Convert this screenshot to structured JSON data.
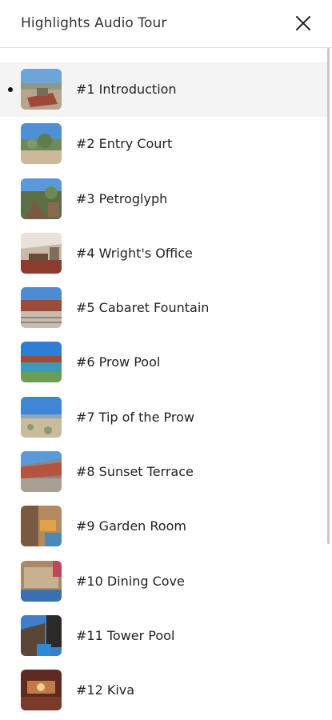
{
  "header": {
    "title": "Highlights Audio Tour",
    "close_icon": "close-icon"
  },
  "tour": {
    "active_index": 0,
    "stops": [
      {
        "label": "#1 Introduction",
        "thumb": "introduction-thumbnail"
      },
      {
        "label": "#2 Entry Court",
        "thumb": "entry-court-thumbnail"
      },
      {
        "label": "#3 Petroglyph",
        "thumb": "petroglyph-thumbnail"
      },
      {
        "label": "#4 Wright's Office",
        "thumb": "wrights-office-thumbnail"
      },
      {
        "label": "#5 Cabaret Fountain",
        "thumb": "cabaret-fountain-thumbnail"
      },
      {
        "label": "#6 Prow Pool",
        "thumb": "prow-pool-thumbnail"
      },
      {
        "label": "#7 Tip of the Prow",
        "thumb": "tip-of-the-prow-thumbnail"
      },
      {
        "label": "#8 Sunset Terrace",
        "thumb": "sunset-terrace-thumbnail"
      },
      {
        "label": "#9 Garden Room",
        "thumb": "garden-room-thumbnail"
      },
      {
        "label": "#10 Dining Cove",
        "thumb": "dining-cove-thumbnail"
      },
      {
        "label": "#11 Tower Pool",
        "thumb": "tower-pool-thumbnail"
      },
      {
        "label": "#12 Kiva",
        "thumb": "kiva-thumbnail"
      }
    ]
  },
  "colors": {
    "active_row": "#f4f4f4",
    "text": "#222222",
    "divider": "#dcdcdc"
  }
}
